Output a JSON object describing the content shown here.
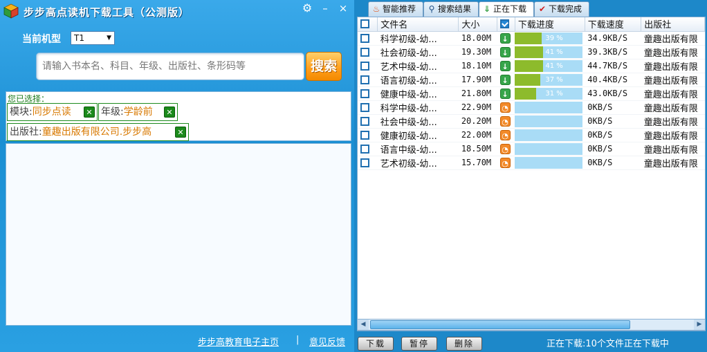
{
  "app": {
    "title": "步步高点读机下载工具（公测版）",
    "settings_glyph": "⚙",
    "minimize_glyph": "–",
    "close_glyph": "×"
  },
  "model": {
    "label": "当前机型",
    "selected": "T1"
  },
  "search": {
    "placeholder": "请输入书本名、科目、年级、出版社、条形码等",
    "value": "",
    "button_label": "搜索"
  },
  "filters": {
    "heading": "您已选择：",
    "chips": [
      {
        "key": "模块:",
        "value": "同步点读"
      },
      {
        "key": "年级:",
        "value": "学龄前"
      },
      {
        "key": "出版社:",
        "value": "童趣出版有限公司.步步高"
      }
    ],
    "remove_glyph": "✕"
  },
  "footer_links": {
    "home": "步步高教育电子主页",
    "separator": "|",
    "feedback": "意见反馈"
  },
  "tabs": [
    {
      "label": "智能推荐",
      "icon": "flame-icon"
    },
    {
      "label": "搜索结果",
      "icon": "magnifier-icon"
    },
    {
      "label": "正在下载",
      "icon": "download-arrow-icon",
      "active": true
    },
    {
      "label": "下载完成",
      "icon": "checkmark-icon"
    }
  ],
  "table": {
    "headers": [
      "文件名",
      "大小",
      "下载进度",
      "下载速度",
      "出版社"
    ],
    "rows": [
      {
        "name": "科学初级-幼...",
        "size": "18.00M",
        "status": "downloading",
        "progress": 39,
        "pct_label": "39 %",
        "speed": "34.9KB/S",
        "publisher": "童趣出版有限"
      },
      {
        "name": "社会初级-幼...",
        "size": "19.30M",
        "status": "downloading",
        "progress": 41,
        "pct_label": "41 %",
        "speed": "39.3KB/S",
        "publisher": "童趣出版有限"
      },
      {
        "name": "艺术中级-幼...",
        "size": "18.10M",
        "status": "downloading",
        "progress": 41,
        "pct_label": "41 %",
        "speed": "44.7KB/S",
        "publisher": "童趣出版有限"
      },
      {
        "name": "语言初级-幼...",
        "size": "17.90M",
        "status": "downloading",
        "progress": 37,
        "pct_label": "37 %",
        "speed": "40.4KB/S",
        "publisher": "童趣出版有限"
      },
      {
        "name": "健康中级-幼...",
        "size": "21.80M",
        "status": "downloading",
        "progress": 31,
        "pct_label": "31 %",
        "speed": "43.0KB/S",
        "publisher": "童趣出版有限"
      },
      {
        "name": "科学中级-幼...",
        "size": "22.90M",
        "status": "waiting",
        "progress": 0,
        "pct_label": "",
        "speed": "0KB/S",
        "publisher": "童趣出版有限"
      },
      {
        "name": "社会中级-幼...",
        "size": "20.20M",
        "status": "waiting",
        "progress": 0,
        "pct_label": "",
        "speed": "0KB/S",
        "publisher": "童趣出版有限"
      },
      {
        "name": "健康初级-幼...",
        "size": "22.00M",
        "status": "waiting",
        "progress": 0,
        "pct_label": "",
        "speed": "0KB/S",
        "publisher": "童趣出版有限"
      },
      {
        "name": "语言中级-幼...",
        "size": "18.50M",
        "status": "waiting",
        "progress": 0,
        "pct_label": "",
        "speed": "0KB/S",
        "publisher": "童趣出版有限"
      },
      {
        "name": "艺术初级-幼...",
        "size": "15.70M",
        "status": "waiting",
        "progress": 0,
        "pct_label": "",
        "speed": "0KB/S",
        "publisher": "童趣出版有限"
      }
    ]
  },
  "actions": {
    "download": "下载",
    "pause": "暂停",
    "delete": "删除"
  },
  "status": "正在下载:10个文件正在下载中",
  "colors": {
    "background": "#1d88c9",
    "progress_fill": "#8dbb2c",
    "progress_track": "#a9dcf6",
    "search_button": "#ff9d1a",
    "chip_value": "#d87800"
  }
}
